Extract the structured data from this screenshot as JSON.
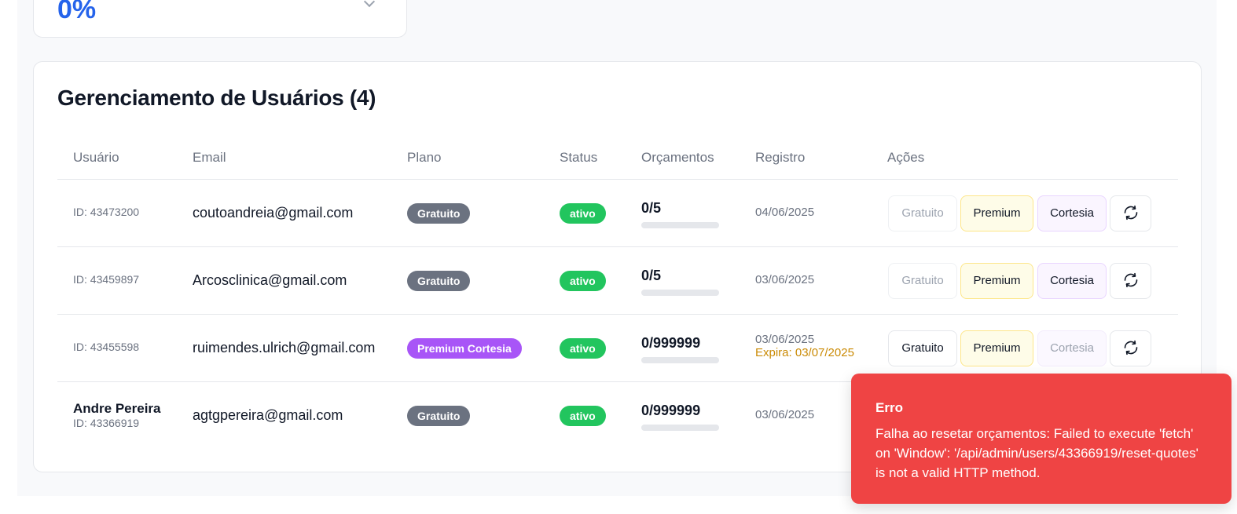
{
  "stats": {
    "value": "0%"
  },
  "section": {
    "title": "Gerenciamento de Usuários (4)"
  },
  "columns": {
    "user": "Usuário",
    "email": "Email",
    "plan": "Plano",
    "status": "Status",
    "quotes": "Orçamentos",
    "registered": "Registro",
    "actions": "Ações"
  },
  "actions": {
    "free": "Gratuito",
    "premium": "Premium",
    "courtesy": "Cortesia",
    "reset_icon": "refresh-icon"
  },
  "users": [
    {
      "name": "",
      "id": "ID: 43473200",
      "email": "coutoandreia@gmail.com",
      "plan": "Gratuito",
      "status": "ativo",
      "quotes": "0/5",
      "quotes_used_fraction": 0,
      "registered": "04/06/2025",
      "expires": "",
      "current_plan_action": "free"
    },
    {
      "name": "",
      "id": "ID: 43459897",
      "email": "Arcosclinica@gmail.com",
      "plan": "Gratuito",
      "status": "ativo",
      "quotes": "0/5",
      "quotes_used_fraction": 0,
      "registered": "03/06/2025",
      "expires": "",
      "current_plan_action": "free"
    },
    {
      "name": "",
      "id": "ID: 43455598",
      "email": "ruimendes.ulrich@gmail.com",
      "plan": "Premium Cortesia",
      "status": "ativo",
      "quotes": "0/999999",
      "quotes_used_fraction": 0,
      "registered": "03/06/2025",
      "expires": "Expira: 03/07/2025",
      "current_plan_action": "courtesy"
    },
    {
      "name": "Andre Pereira",
      "id": "ID: 43366919",
      "email": "agtgpereira@gmail.com",
      "plan": "Gratuito",
      "status": "ativo",
      "quotes": "0/999999",
      "quotes_used_fraction": 0,
      "registered": "03/06/2025",
      "expires": "",
      "current_plan_action": "free"
    }
  ],
  "toast": {
    "title": "Erro",
    "message": "Falha ao resetar orçamentos: Failed to execute 'fetch' on 'Window': '/api/admin/users/43366919/reset-quotes' is not a valid HTTP method."
  },
  "colors": {
    "accent": "#2563eb",
    "status_active": "#22c55e",
    "plan_free": "#6b7280",
    "plan_premium_courtesy": "#a855f7",
    "toast_error": "#ef4444"
  }
}
